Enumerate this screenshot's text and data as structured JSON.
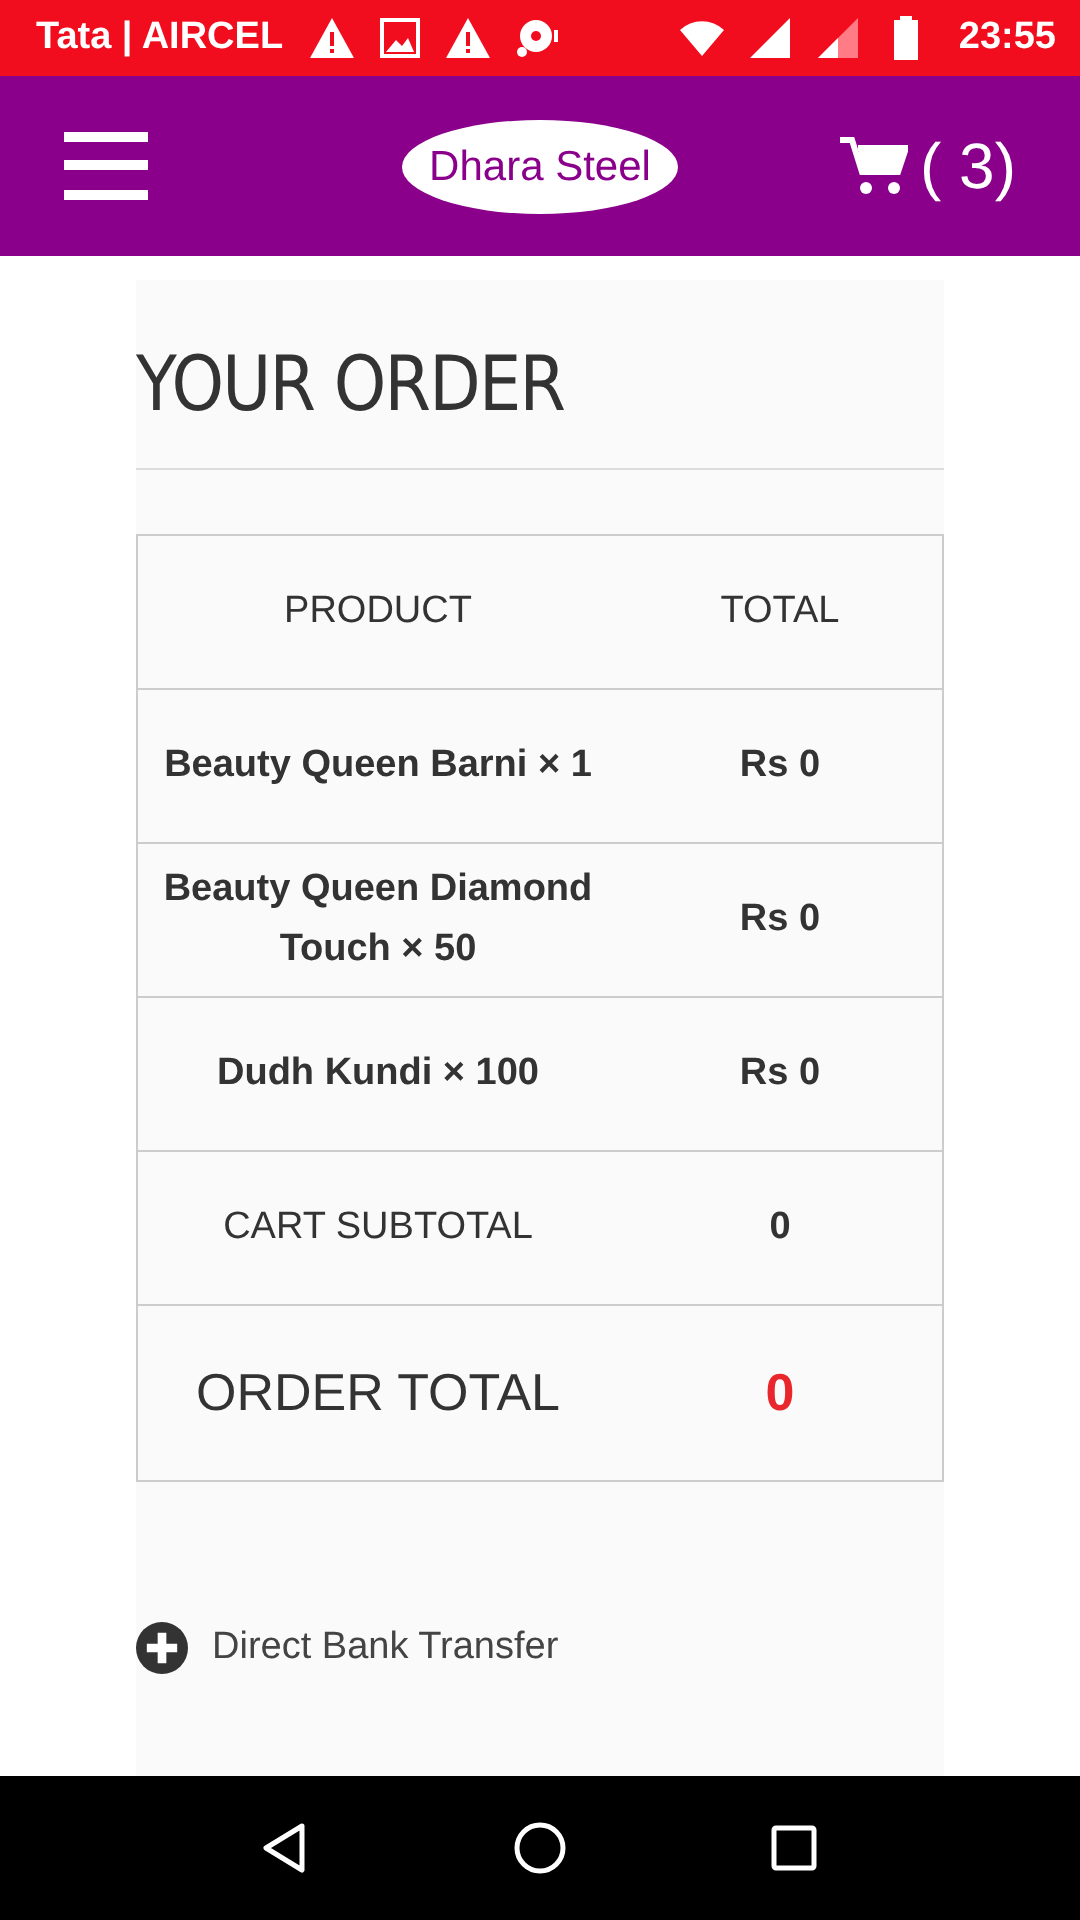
{
  "status_bar": {
    "carrier": "Tata | AIRCEL",
    "time": "23:55"
  },
  "header": {
    "logo": "Dhara Steel",
    "cart_count": "( 3)"
  },
  "title": "YOUR ORDER",
  "table": {
    "columns": [
      "PRODUCT",
      "TOTAL"
    ],
    "rows": [
      {
        "kind": "item",
        "product": "Beauty Queen Barni × 1",
        "total": "Rs 0"
      },
      {
        "kind": "item",
        "product": "Beauty Queen Diamond Touch × 50",
        "total": "Rs 0"
      },
      {
        "kind": "item",
        "product": "Dudh Kundi × 100",
        "total": "Rs 0"
      },
      {
        "kind": "subtotal",
        "product": "CART SUBTOTAL",
        "total": "0"
      },
      {
        "kind": "total",
        "product": "ORDER TOTAL",
        "total": "0"
      }
    ]
  },
  "payment_methods": [
    {
      "label": "Direct Bank Transfer"
    }
  ]
}
